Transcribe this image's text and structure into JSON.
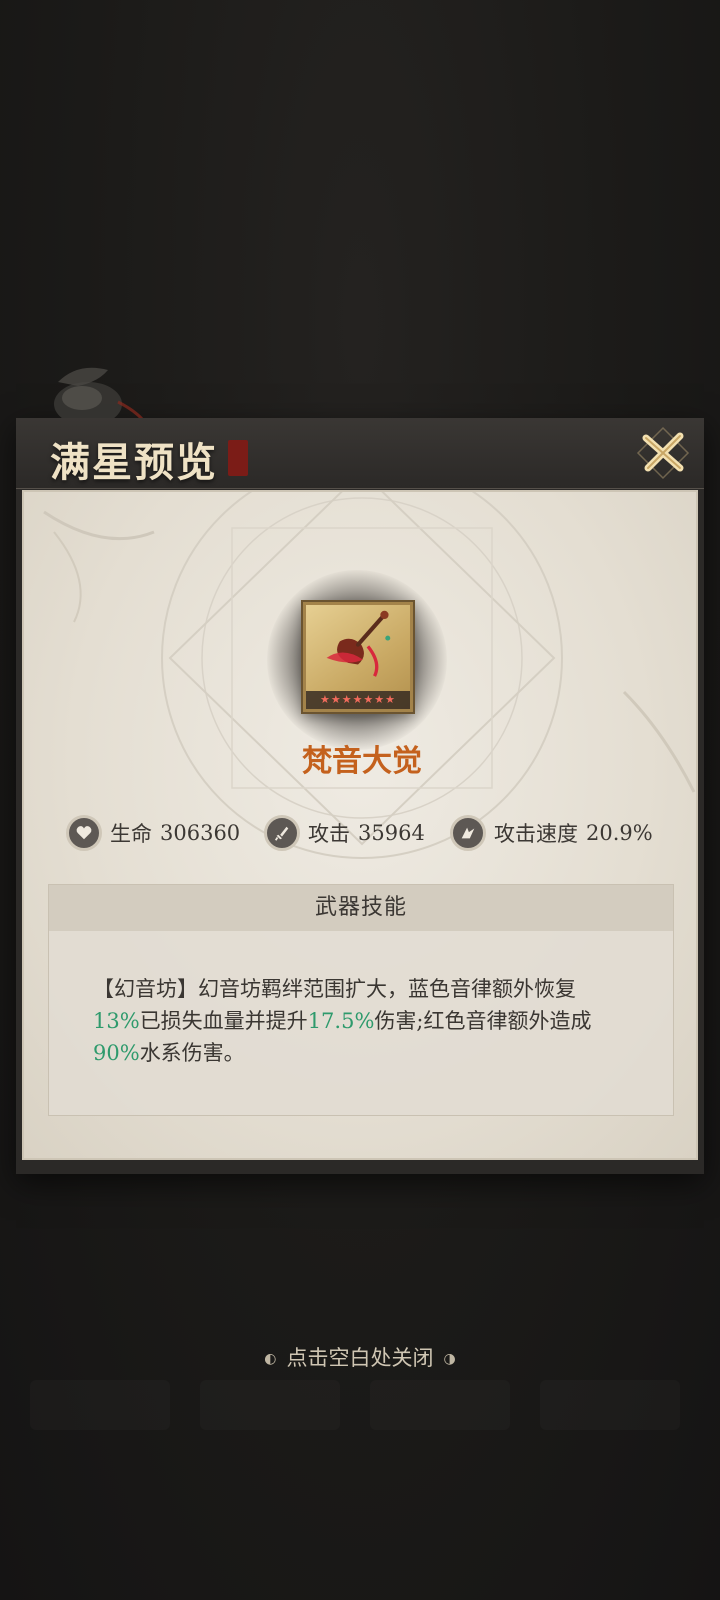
{
  "panel": {
    "title": "满星预览",
    "close_icon": "close-x-icon"
  },
  "item": {
    "name": "梵音大觉",
    "icon": "pipa-weapon-icon",
    "stars": 7,
    "star_glyphs": "★★★★★★★"
  },
  "stats": {
    "hp": {
      "label": "生命",
      "value": "306360",
      "icon": "heart-icon"
    },
    "atk": {
      "label": "攻击",
      "value": "35964",
      "icon": "dagger-icon"
    },
    "atk_speed": {
      "label": "攻击速度",
      "value": "20.9%",
      "icon": "wind-blade-icon"
    }
  },
  "skill": {
    "heading": "武器技能",
    "desc_parts": {
      "p1": "【幻音坊】幻音坊羁绊范围扩大，",
      "p2": "蓝色音律额外恢复",
      "v1": "13%",
      "p3": "已损失血量并提升",
      "v2": "17.5%",
      "p4": "伤害;红色音律额外造成",
      "v3": "90%",
      "p5": "水系伤害。"
    },
    "highlight_color": "#2e9a6c"
  },
  "hint": {
    "text": "点击空白处关闭"
  },
  "colors": {
    "item_name": "#c4611d",
    "title": "#efe2c5",
    "panel_bg": "#e4ded2"
  }
}
